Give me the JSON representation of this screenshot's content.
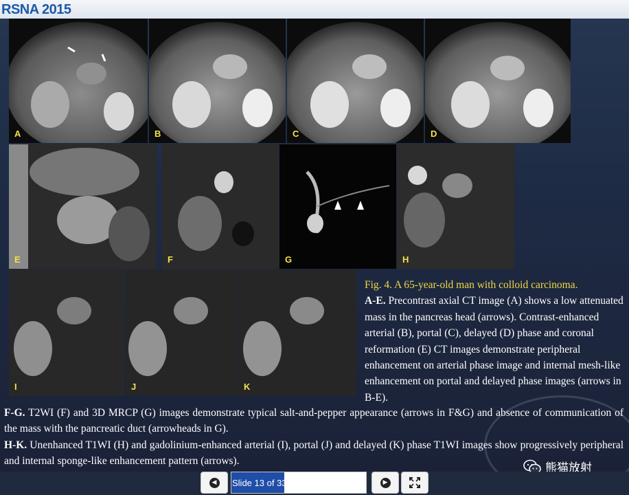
{
  "header": {
    "logo_text": "RSNA 2015"
  },
  "panels": {
    "A": "A",
    "B": "B",
    "C": "C",
    "D": "D",
    "E": "E",
    "F": "F",
    "G": "G",
    "H": "H",
    "I": "I",
    "J": "J",
    "K": "K"
  },
  "caption_right": {
    "title": "Fig. 4. A 65-year-old man with colloid carcinoma.",
    "ae_label": "A-E.",
    "ae_text": " Precontrast axial CT image (A) shows a low attenuated mass in the pancreas head (arrows). Contrast-enhanced arterial (B), portal (C), delayed (D) phase and coronal reformation (E) CT images demonstrate peripheral enhancement on arterial phase image and internal mesh-like enhancement on portal and delayed phase images (arrows in B-E)."
  },
  "caption_bottom": {
    "fg_label": "F-G.",
    "fg_text": " T2WI (F) and 3D MRCP (G) images demonstrate typical salt-and-pepper appearance (arrows in F&G) and absence of communication of the mass with the pancreatic duct (arrowheads in G).",
    "hk_label": "H-K.",
    "hk_text": " Unenhanced T1WI (H) and gadolinium-enhanced arterial (I), portal (J) and delayed (K) phase T1WI images show progressively peripheral and internal sponge-like enhancement pattern (arrows)."
  },
  "watermark": {
    "text": "熊猫放射",
    "icon": "wechat-icon"
  },
  "controls": {
    "prev_icon": "◀",
    "next_icon": "▶",
    "fullscreen_icon": "expand-icon",
    "slide_text": "Slide 13 of 33",
    "slide_current": 13,
    "slide_total": 33
  },
  "colors": {
    "label_yellow": "#f2e24a",
    "caption_title": "#f0d844",
    "progress_blue": "#1f4ea8"
  }
}
